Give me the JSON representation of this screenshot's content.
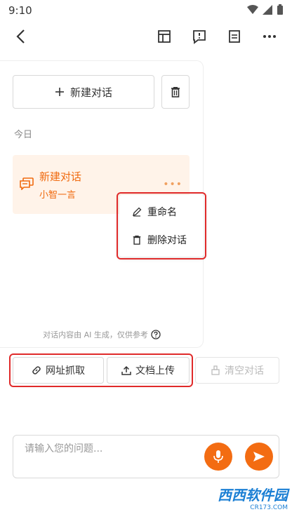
{
  "status_bar": {
    "time": "9:10"
  },
  "sidebar": {
    "new_chat_label": "新建对话",
    "section_today": "今日",
    "conversation": {
      "title": "新建对话",
      "subtitle": "小智一言",
      "more": "•••"
    },
    "disclaimer": "对话内容由 AI 生成，仅供参考"
  },
  "context_menu": {
    "items": [
      {
        "label": "重命名",
        "icon": "pencil-icon"
      },
      {
        "label": "删除对话",
        "icon": "trash-icon"
      }
    ]
  },
  "tools": {
    "web_fetch": "网址抓取",
    "doc_upload": "文档上传",
    "clear": "清空对话"
  },
  "input": {
    "placeholder": "请输入您的问题..."
  },
  "watermark": {
    "brand": "西西软件园",
    "site": "CR173.COM"
  },
  "colors": {
    "accent": "#f36c12",
    "highlight": "#e02a2a",
    "conv_bg": "#fff3e9"
  }
}
